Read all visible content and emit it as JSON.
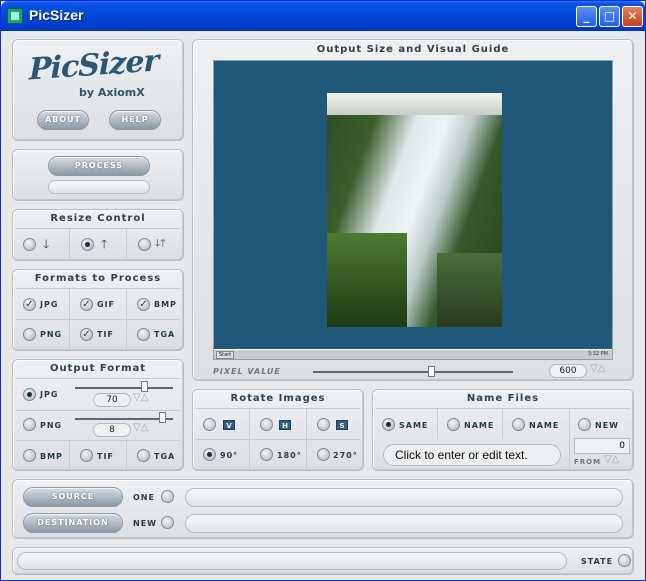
{
  "window": {
    "title": "PicSizer"
  },
  "logo": {
    "name": "PicSizer",
    "byline": "by AxiomX"
  },
  "buttons": {
    "about": "ABOUT",
    "help": "HELP",
    "process": "PROCESS",
    "source": "SOURCE",
    "destination": "DESTINATION"
  },
  "resize": {
    "title": "Resize Control",
    "options": [
      "shrink",
      "grow",
      "both"
    ],
    "selected": "grow"
  },
  "formats": {
    "title": "Formats to Process",
    "items": [
      {
        "label": "JPG",
        "checked": true
      },
      {
        "label": "GIF",
        "checked": true
      },
      {
        "label": "BMP",
        "checked": true
      },
      {
        "label": "PNG",
        "checked": false
      },
      {
        "label": "TIF",
        "checked": true
      },
      {
        "label": "TGA",
        "checked": false
      }
    ]
  },
  "output_format": {
    "title": "Output Format",
    "jpg": "JPG",
    "jpg_value": "70",
    "png": "PNG",
    "png_value": "8",
    "bmp": "BMP",
    "tif": "TIF",
    "tga": "TGA",
    "selected": "JPG"
  },
  "guide": {
    "title": "Output Size and Visual Guide",
    "pixel_label": "PIXEL VALUE",
    "pixel_value": "600",
    "taskbar_start": "Start",
    "taskbar_time": "3:32 PM"
  },
  "rotate": {
    "title": "Rotate Images",
    "v": "V",
    "h": "H",
    "s": "S",
    "r90": "90°",
    "r180": "180°",
    "r270": "270°",
    "selected": "90°"
  },
  "name_files": {
    "title": "Name Files",
    "same": "SAME",
    "name1": "NAME",
    "name2": "NAME",
    "new": "NEW",
    "text_placeholder": "Click to enter or edit text.",
    "from_label": "FROM",
    "from_value": "0",
    "selected": "SAME"
  },
  "paths": {
    "one_label": "ONE",
    "new_label": "NEW"
  },
  "status": {
    "state_label": "STATE"
  }
}
